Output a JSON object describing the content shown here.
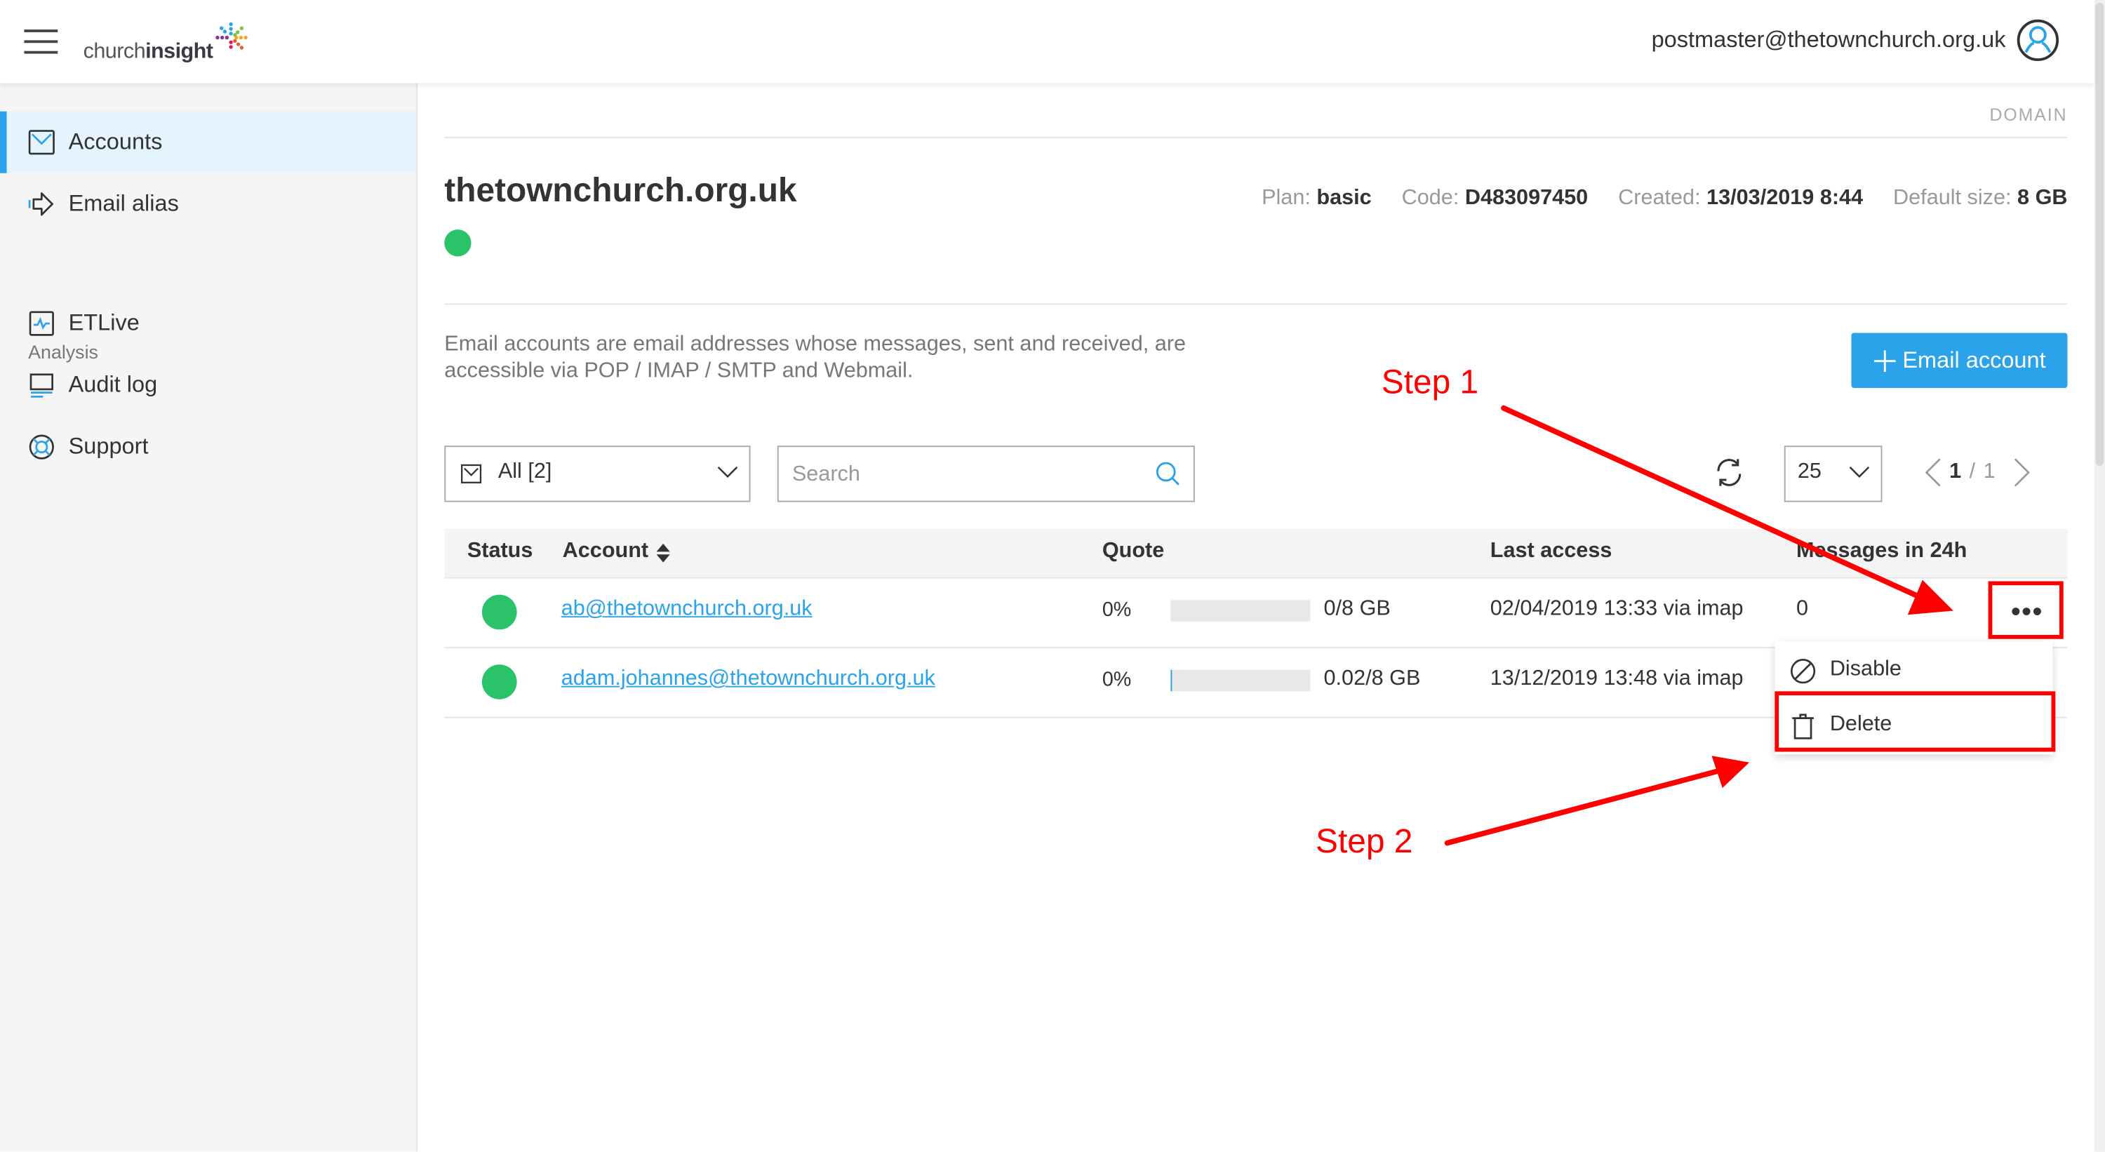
{
  "header": {
    "menu_icon": "hamburger-icon",
    "logo_text_light": "church",
    "logo_text_bold": "insight",
    "user_email": "postmaster@thetownchurch.org.uk",
    "avatar_icon": "user-circle-icon"
  },
  "sidebar": {
    "items": [
      {
        "label": "Accounts",
        "icon": "envelope-icon",
        "active": true
      },
      {
        "label": "Email alias",
        "icon": "forward-arrow-icon",
        "active": false
      }
    ],
    "section_label": "Analysis",
    "analysis_items": [
      {
        "label": "ETLive",
        "icon": "pulse-chart-icon"
      },
      {
        "label": "Audit log",
        "icon": "monitor-icon"
      },
      {
        "label": "Support",
        "icon": "lifebuoy-icon"
      }
    ]
  },
  "main": {
    "section_tag": "DOMAIN",
    "domain_name": "thetownchurch.org.uk",
    "domain_status": "active",
    "meta": {
      "plan_label": "Plan:",
      "plan_value": "basic",
      "code_label": "Code:",
      "code_value": "D483097450",
      "created_label": "Created:",
      "created_value": "13/03/2019 8:44",
      "size_label": "Default size:",
      "size_value": "8 GB"
    },
    "description": "Email accounts are email addresses whose messages, sent and received, are accessible via POP / IMAP / SMTP and Webmail.",
    "add_button_label": "Email account",
    "filter": {
      "value": "All [2]"
    },
    "search": {
      "placeholder": "Search",
      "value": ""
    },
    "per_page": "25",
    "pagination": {
      "current": "1",
      "separator": "/",
      "total": "1"
    },
    "table": {
      "headers": {
        "status": "Status",
        "account": "Account",
        "quote": "Quote",
        "last_access": "Last access",
        "messages": "Messages in 24h"
      },
      "rows": [
        {
          "status": "active",
          "account": "ab@thetownchurch.org.uk",
          "percent": "0%",
          "usage_fraction": 0,
          "quota": "0/8 GB",
          "last_access": "02/04/2019 13:33 via imap",
          "messages": "0"
        },
        {
          "status": "active",
          "account": "adam.johannes@thetownchurch.org.uk",
          "percent": "0%",
          "usage_fraction": 0.0025,
          "quota": "0.02/8 GB",
          "last_access": "13/12/2019 13:48 via imap",
          "messages": ""
        }
      ]
    },
    "row_menu_button": "•••",
    "row_menu": [
      {
        "label": "Disable",
        "icon": "block-icon"
      },
      {
        "label": "Delete",
        "icon": "trash-icon"
      }
    ]
  },
  "annotations": {
    "step1": "Step 1",
    "step2": "Step 2",
    "color": "#ff0000"
  },
  "colors": {
    "accent": "#2ba3ea",
    "status_ok": "#2ac36a",
    "sidebar_bg": "#f5f5f5",
    "sidebar_active_bg": "#e5f3fc"
  }
}
